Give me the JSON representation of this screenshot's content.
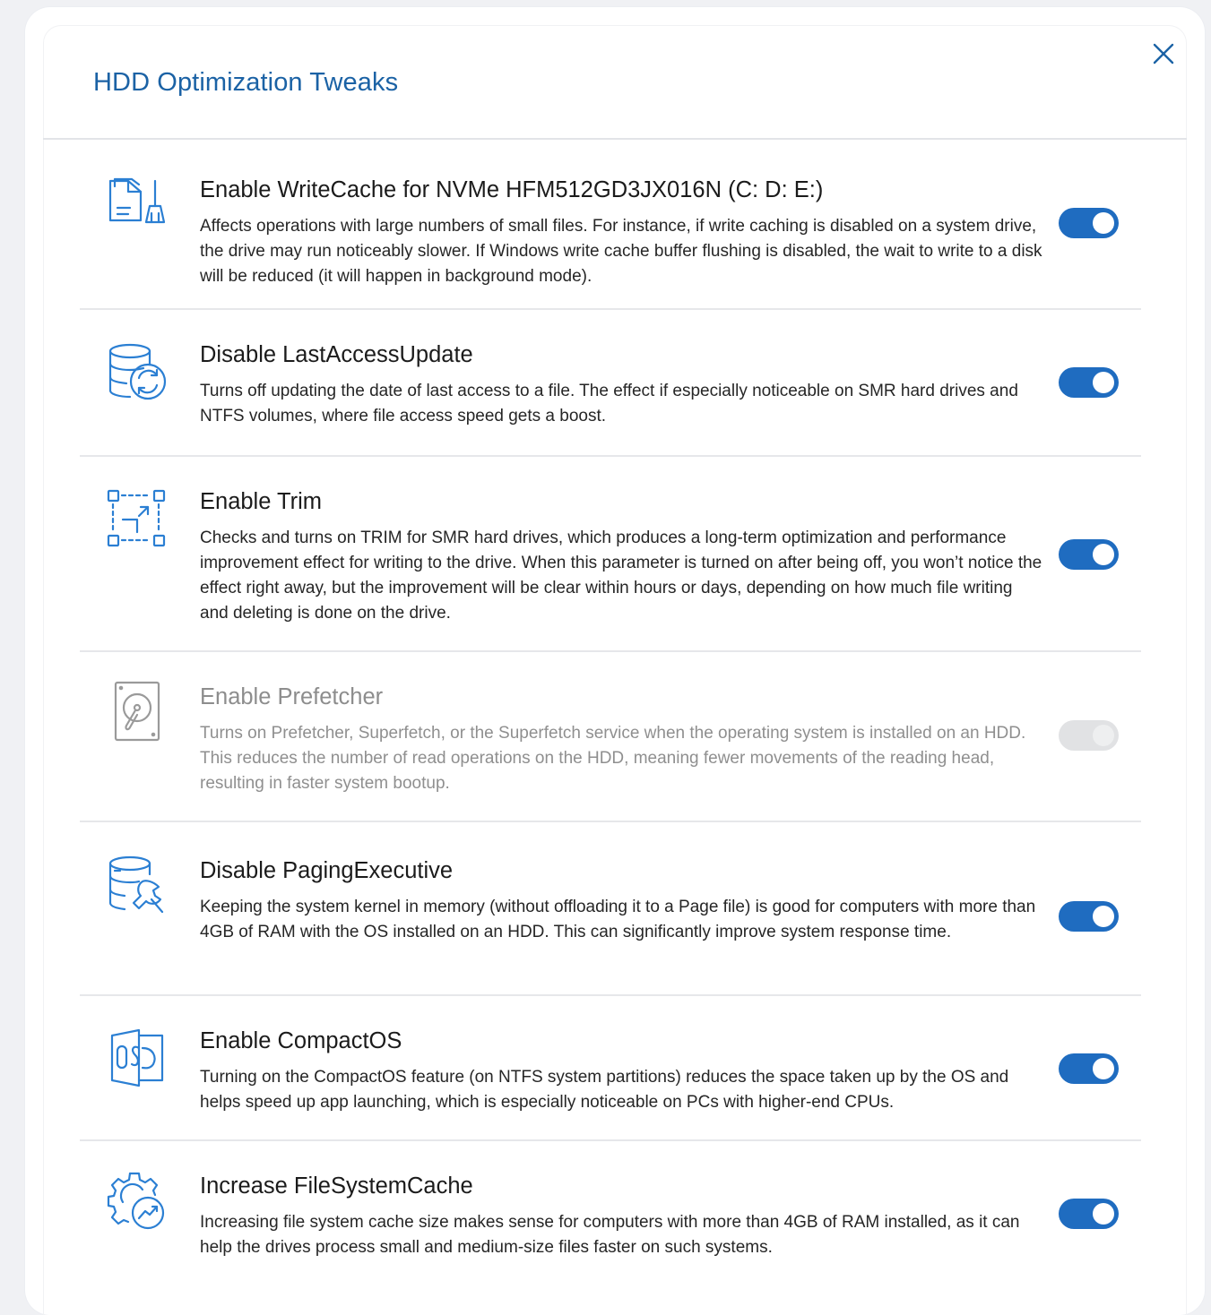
{
  "dialog": {
    "title": "HDD Optimization Tweaks",
    "close_icon": "close-icon"
  },
  "colors": {
    "accent": "#1f6cc0",
    "title": "#1b62a5",
    "icon": "#2b7fd3",
    "disabled_icon": "#9a9a9a",
    "toggle_off": "#e1e2e4"
  },
  "tweaks": [
    {
      "icon": "file-broom-icon",
      "title": "Enable WriteCache for NVMe HFM512GD3JX016N (C: D: E:)",
      "description": "Affects operations with large numbers of small files. For instance, if write caching is disabled on a system drive, the drive may run noticeably slower. If Windows write cache buffer flushing is disabled, the wait to write to a disk will be reduced (it will happen in background mode).",
      "enabled": true,
      "available": true
    },
    {
      "icon": "database-refresh-icon",
      "title": "Disable LastAccessUpdate",
      "description": "Turns off updating the date of last access to a file. The effect if especially noticeable on SMR hard drives and NTFS volumes, where file access speed gets a boost.",
      "enabled": true,
      "available": true
    },
    {
      "icon": "trim-selection-icon",
      "title": "Enable Trim",
      "description": "Checks and turns on TRIM for SMR hard drives, which produces a long-term optimization and performance improvement effect for writing to the drive. When this parameter is turned on after being off, you won’t notice the effect right away, but the improvement will be clear within hours or days, depending on how much file writing and deleting is done on the drive.",
      "enabled": true,
      "available": true
    },
    {
      "icon": "hard-drive-icon",
      "title": "Enable Prefetcher",
      "description": "Turns on Prefetcher, Superfetch, or the Superfetch service when the operating system is installed on an HDD. This reduces the number of read operations on the HDD, meaning fewer movements of the reading head, resulting in faster system bootup.",
      "enabled": false,
      "available": false
    },
    {
      "icon": "database-wrench-icon",
      "title": "Disable PagingExecutive",
      "description": "Keeping the system kernel in memory (without offloading it to a Page file) is good for computers with more than 4GB of RAM with the OS installed on an HDD. This can significantly improve system response time.",
      "enabled": true,
      "available": true
    },
    {
      "icon": "compact-os-icon",
      "title": "Enable CompactOS",
      "description": "Turning on the CompactOS feature (on NTFS system partitions) reduces the space taken up by the OS and helps speed up app launching, which is especially noticeable on PCs with higher-end CPUs.",
      "enabled": true,
      "available": true
    },
    {
      "icon": "gear-speed-icon",
      "title": "Increase FileSystemCache",
      "description": "Increasing file system cache size makes sense for computers with more than 4GB of RAM installed, as it can help the drives process small and medium-size files faster on such systems.",
      "enabled": true,
      "available": true
    }
  ]
}
